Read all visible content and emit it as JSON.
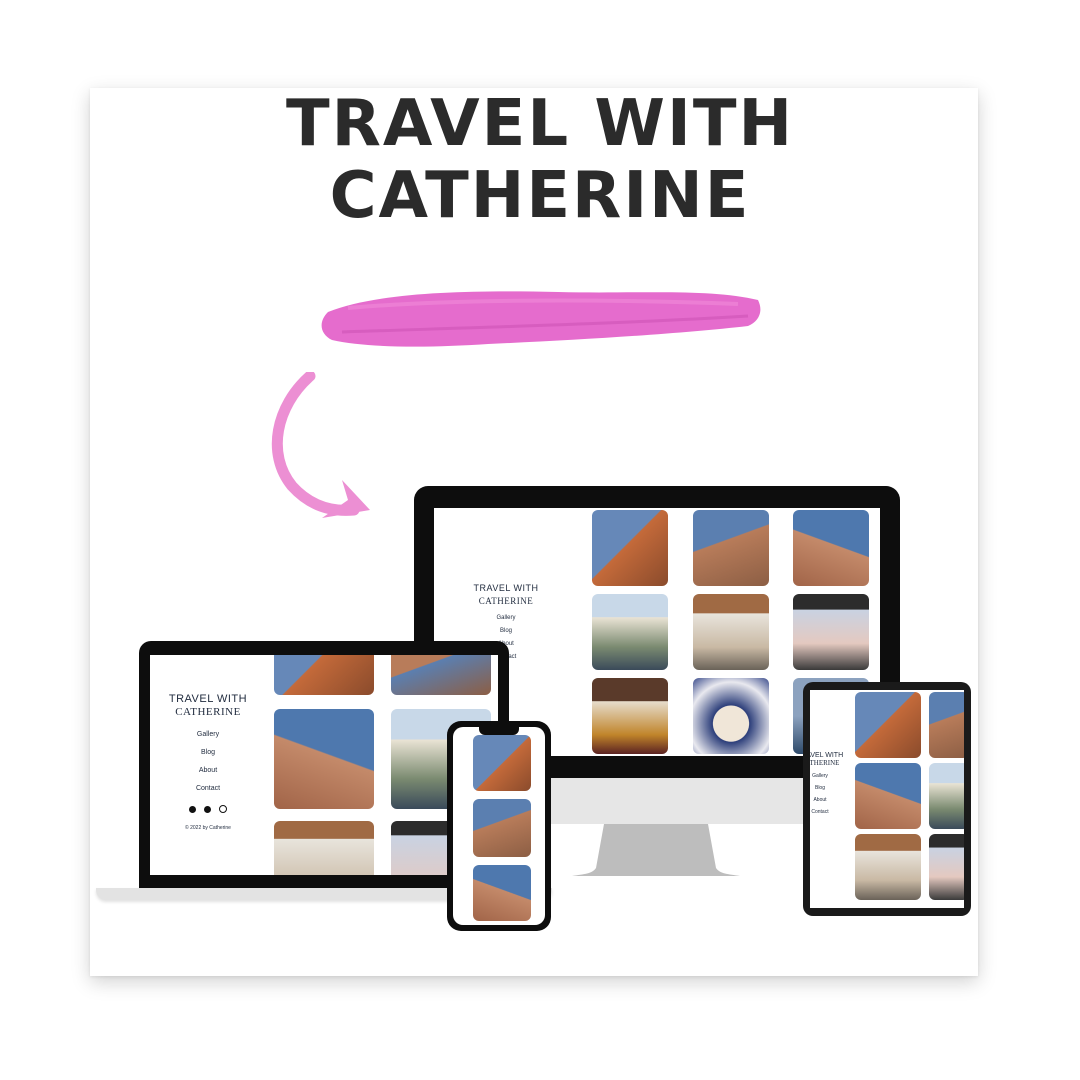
{
  "headline": {
    "line1": "TRAVEL WITH",
    "line2": "CATHERINE"
  },
  "colors": {
    "accent_brush": "#e35fc9",
    "arrow": "#ec8fd3",
    "headline": "#2b2b2b",
    "screen_bezel": "#0d0d0d",
    "nav_text": "#1f2a3d"
  },
  "site": {
    "title_line1": "TRAVEL WITH",
    "title_line2": "CATHERINE",
    "nav": [
      "Gallery",
      "Blog",
      "About",
      "Contact"
    ],
    "social_icons": [
      "github-icon",
      "medium-icon",
      "globe-icon"
    ],
    "footer": "© 2022 by Catherine"
  },
  "desktop": {
    "nav": [
      "Gallery",
      "Blog",
      "About",
      "Contact"
    ]
  }
}
